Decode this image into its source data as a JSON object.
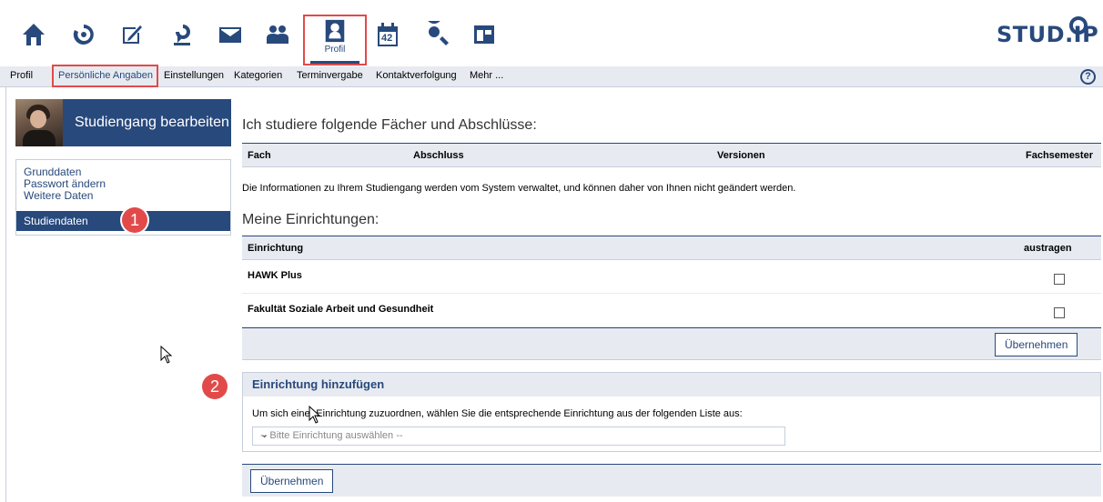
{
  "topnav": {
    "icons": [
      "home-icon",
      "activity-icon",
      "courses-icon",
      "community-icon",
      "mail-icon",
      "contacts-icon",
      "profile-icon",
      "calendar-icon",
      "search-icon",
      "tools-icon"
    ],
    "profile_label": "Profil",
    "calendar_day": "42",
    "logo_text": "STUD.IP"
  },
  "subnav": {
    "items": [
      "Profil",
      "Persönliche Angaben",
      "Einstellungen",
      "Kategorien",
      "Terminvergabe",
      "Kontaktverfolgung",
      "Mehr ..."
    ],
    "help": "?"
  },
  "sidebar": {
    "title": "Studiengang bearbeiten",
    "items": [
      "Grunddaten",
      "Passwort ändern",
      "Weitere Daten",
      "Studiendaten"
    ],
    "badge": "1"
  },
  "main": {
    "heading_study": "Ich studiere folgende Fächer und Abschlüsse:",
    "study_columns": [
      "Fach",
      "Abschluss",
      "Versionen",
      "Fachsemester"
    ],
    "note": "Die Informationen zu Ihrem Studiengang werden vom System verwaltet, und können daher von Ihnen nicht geändert werden.",
    "heading_inst": "Meine Einrichtungen:",
    "inst_columns": [
      "Einrichtung",
      "austragen"
    ],
    "institutions": [
      "HAWK Plus",
      "Fakultät Soziale Arbeit und Gesundheit"
    ],
    "submit_label": "Übernehmen",
    "add_badge": "2",
    "add_legend": "Einrichtung hinzufügen",
    "add_text": "Um sich einer Einrichtung zuzuordnen, wählen Sie die entsprechende Einrichtung aus der folgenden Liste aus:",
    "select_placeholder": "-- Bitte Einrichtung auswählen --",
    "submit_label_2": "Übernehmen"
  },
  "colors": {
    "brand": "#28497c",
    "highlight": "#e24a4a",
    "panel": "#e7ebf1"
  }
}
